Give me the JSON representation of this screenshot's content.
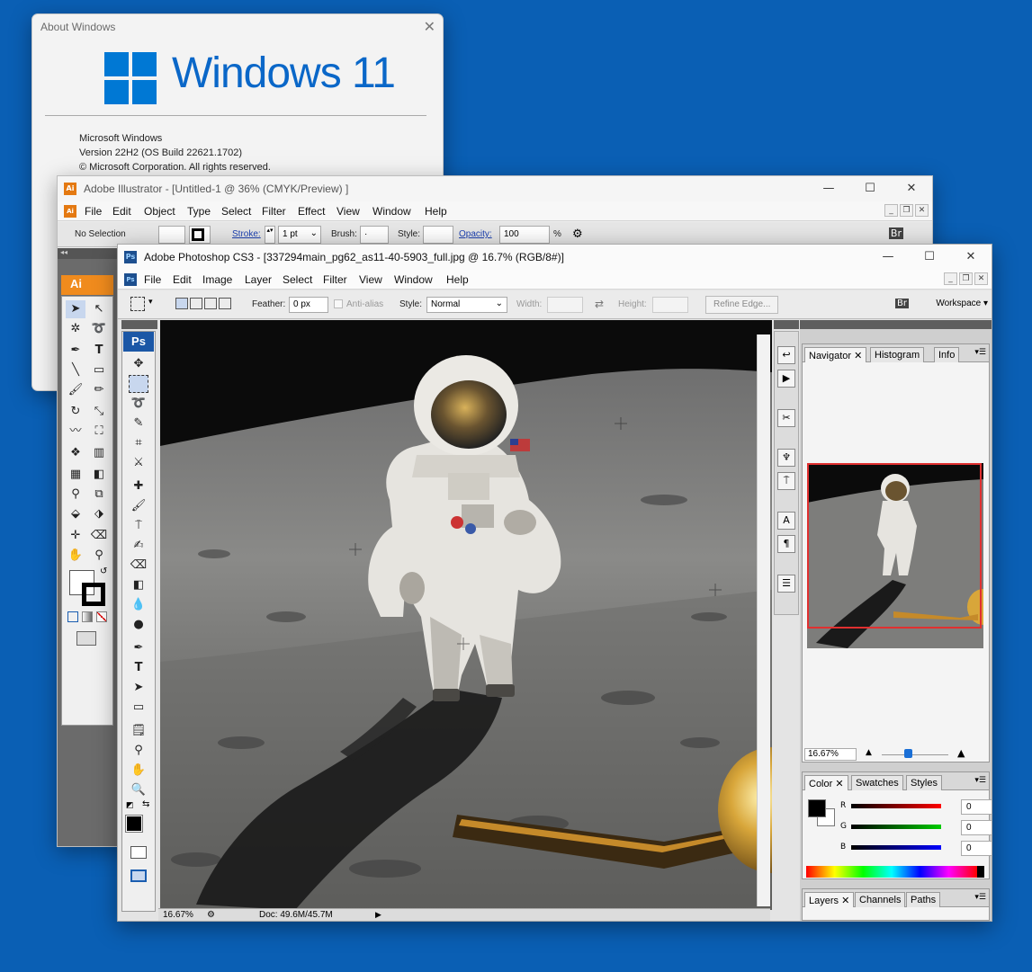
{
  "about": {
    "title": "About Windows",
    "brand": "Windows 11",
    "product": "Microsoft Windows",
    "version": "Version 22H2 (OS Build 22621.1702)",
    "copyright": "© Microsoft Corporation. All rights reserved."
  },
  "illustrator": {
    "title": "Adobe Illustrator - [Untitled-1 @ 36% (CMYK/Preview) ]",
    "app_badge": "Ai",
    "icon_label": "Ai",
    "menu": [
      "File",
      "Edit",
      "Object",
      "Type",
      "Select",
      "Filter",
      "Effect",
      "View",
      "Window",
      "Help"
    ],
    "control": {
      "selection": "No Selection",
      "stroke_label": "Stroke:",
      "stroke_value": "1 pt",
      "brush_label": "Brush:",
      "style_label": "Style:",
      "opacity_label": "Opacity:",
      "opacity_value": "100",
      "percent": "%"
    }
  },
  "photoshop": {
    "title": "Adobe Photoshop CS3 - [337294main_pg62_as11-40-5903_full.jpg @ 16.7% (RGB/8#)]",
    "app_badge": "Ps",
    "icon_label": "Ps",
    "menu": [
      "File",
      "Edit",
      "Image",
      "Layer",
      "Select",
      "Filter",
      "View",
      "Window",
      "Help"
    ],
    "options": {
      "feather_label": "Feather:",
      "feather_value": "0 px",
      "antialias": "Anti-alias",
      "style_label": "Style:",
      "style_value": "Normal",
      "width_label": "Width:",
      "height_label": "Height:",
      "refine_edge": "Refine Edge...",
      "workspace": "Workspace ▾"
    },
    "status": {
      "zoom": "16.67%",
      "doc": "Doc: 49.6M/45.7M"
    },
    "navigator": {
      "tabs": [
        "Navigator",
        "Histogram",
        "Info"
      ],
      "zoom": "16.67%"
    },
    "color": {
      "tabs": [
        "Color",
        "Swatches",
        "Styles"
      ],
      "channels": [
        {
          "label": "R",
          "value": "0"
        },
        {
          "label": "G",
          "value": "0"
        },
        {
          "label": "B",
          "value": "0"
        }
      ]
    },
    "layers": {
      "tabs": [
        "Layers",
        "Channels",
        "Paths"
      ]
    }
  },
  "colors": {
    "desktop": "#0a5fb4",
    "windows_blue": "#0078d4",
    "ai_orange": "#f08b1d",
    "ps_blue": "#1b57a6",
    "nav_frame": "#e03030"
  }
}
